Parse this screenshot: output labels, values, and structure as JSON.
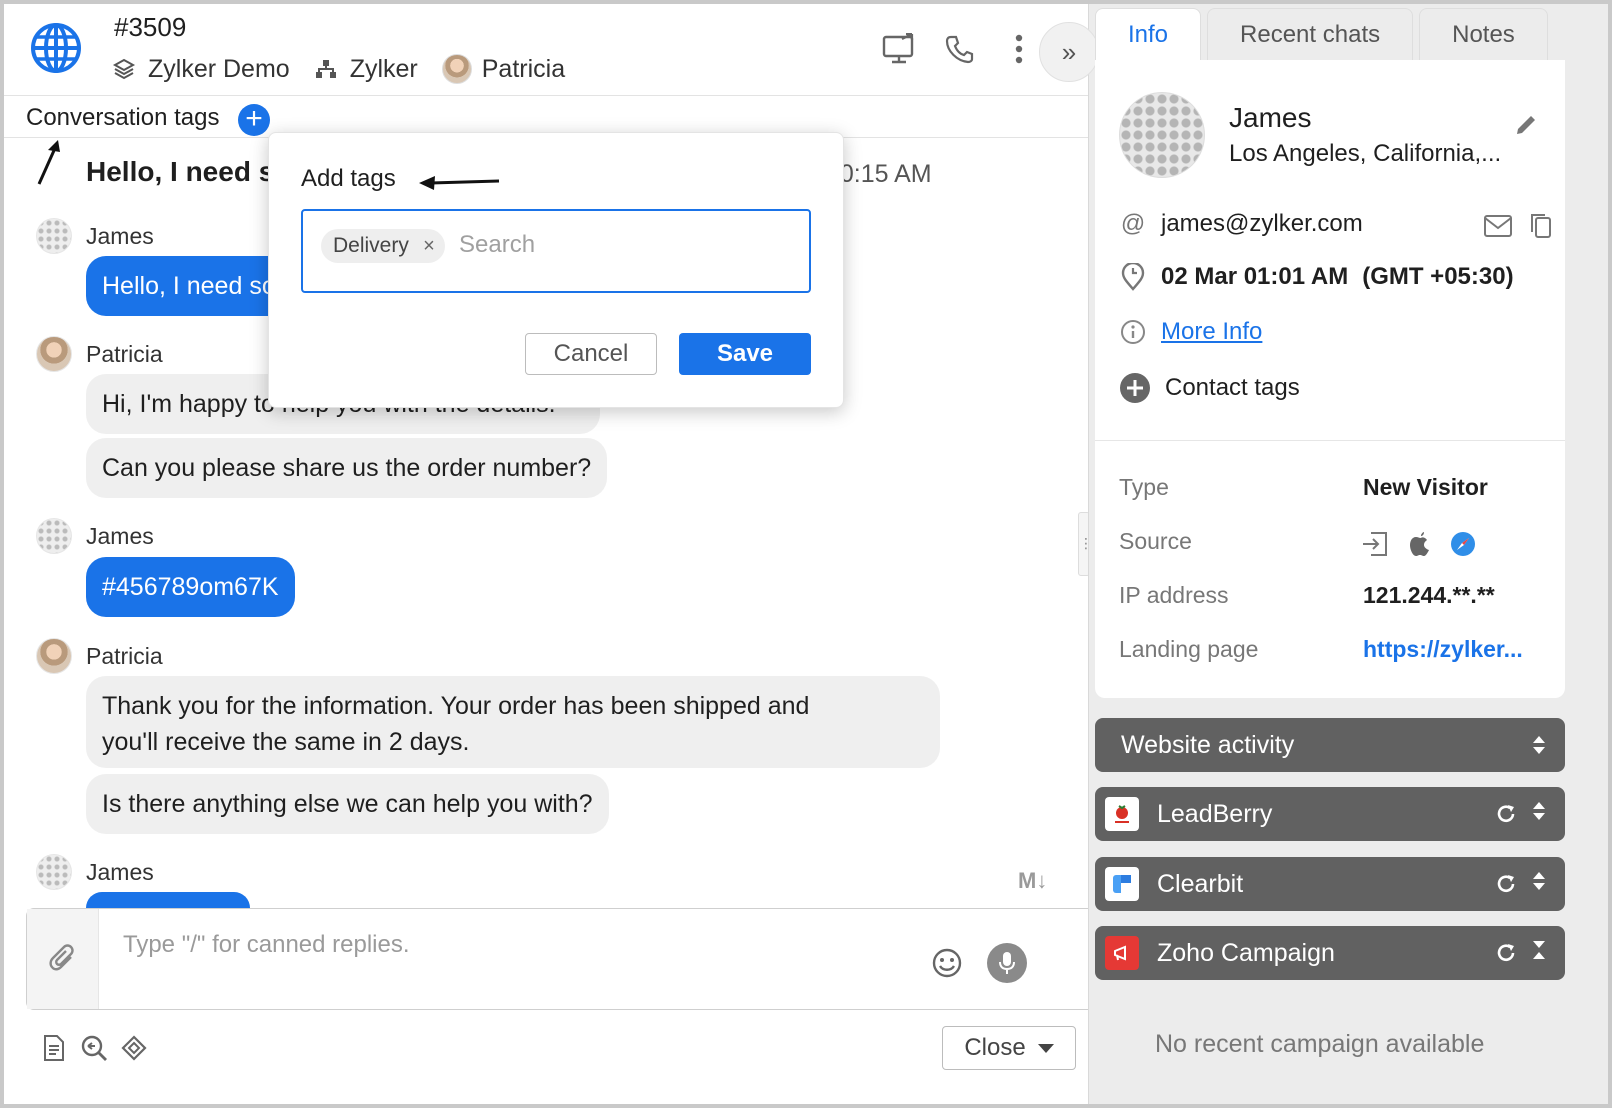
{
  "header": {
    "chat_id": "#3509",
    "portal": "Zylker Demo",
    "department": "Zylker",
    "operator": "Patricia"
  },
  "conversation_tags": {
    "label": "Conversation tags",
    "add_symbol": "+"
  },
  "subject": {
    "text": "Hello, I need some details about my order",
    "time": "10:15 AM"
  },
  "messages": [
    {
      "sender": "James",
      "bubbles": [
        "Hello, I need some details about my order"
      ]
    },
    {
      "sender": "Patricia",
      "bubbles": [
        "Hi, I'm happy to help you with the details.",
        "Can you please share us the order number?"
      ]
    },
    {
      "sender": "James",
      "bubbles": [
        "#456789om67K"
      ]
    },
    {
      "sender": "Patricia",
      "bubbles": [
        "Thank you for the information. Your order has been shipped and",
        "you'll receive the same in 2 days.",
        "Is there anything else we can help you with?"
      ]
    },
    {
      "sender": "James",
      "bubbles": [
        ""
      ]
    }
  ],
  "markdown_indicator": "M↓",
  "composer": {
    "placeholder": "Type \"/\" for canned replies."
  },
  "close_button": {
    "label": "Close"
  },
  "add_tags_popup": {
    "title": "Add tags",
    "selected_tags": [
      "Delivery"
    ],
    "remove_symbol": "×",
    "search_placeholder": "Search",
    "cancel_label": "Cancel",
    "save_label": "Save"
  },
  "right_panel": {
    "tabs": [
      {
        "label": "Info",
        "active": true
      },
      {
        "label": "Recent chats",
        "active": false
      },
      {
        "label": "Notes",
        "active": false
      }
    ],
    "visitor": {
      "name": "James",
      "location": "Los Angeles, California,...",
      "email": "james@zylker.com",
      "local_time": "02 Mar 01:01 AM",
      "timezone": "(GMT +05:30)",
      "more_info_label": "More Info",
      "contact_tags_label": "Contact tags"
    },
    "details": [
      {
        "key": "Type",
        "value": "New Visitor"
      },
      {
        "key": "Source",
        "value": ""
      },
      {
        "key": "IP address",
        "value": "121.244.**.**"
      },
      {
        "key": "Landing page",
        "value": "https://zylker..."
      }
    ],
    "source_icons": [
      "sign-in-icon",
      "apple-icon",
      "safari-icon"
    ],
    "integrations": [
      {
        "label": "Website activity",
        "logo": ""
      },
      {
        "label": "LeadBerry",
        "logo": "leadberry-logo"
      },
      {
        "label": "Clearbit",
        "logo": "clearbit-logo"
      },
      {
        "label": "Zoho Campaign",
        "logo": "zoho-campaign-logo"
      }
    ],
    "no_campaign_text": "No recent campaign available"
  },
  "colors": {
    "accent": "#1a73e8",
    "accordion_bg": "#616161",
    "bubble_gray": "#efefef"
  }
}
